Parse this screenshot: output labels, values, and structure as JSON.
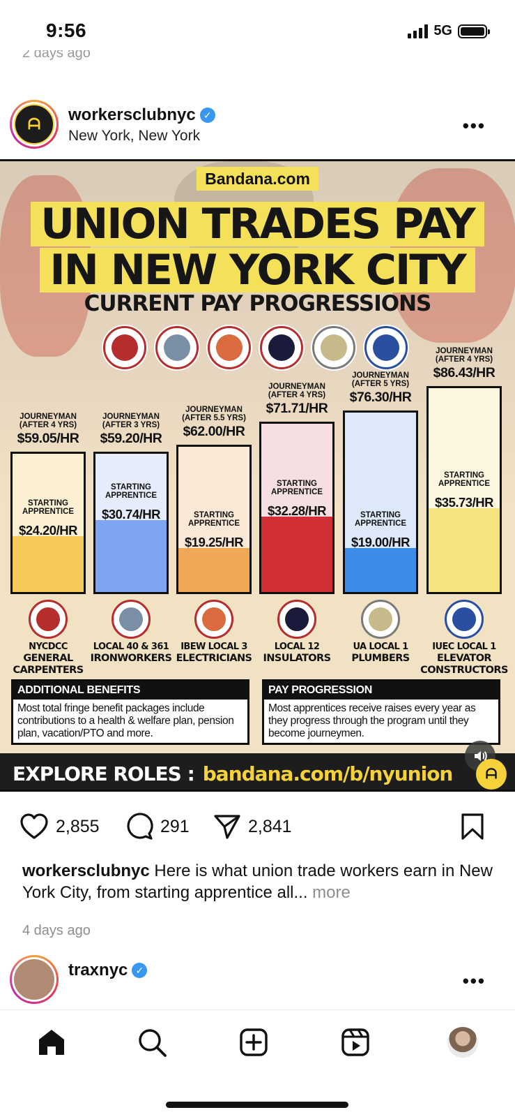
{
  "status_bar": {
    "time": "9:56",
    "network": "5G"
  },
  "previous_post": {
    "time_ago": "2 days ago"
  },
  "post": {
    "username": "workersclubnyc",
    "location": "New York, New York",
    "avatar_text": "Workers Club NYC",
    "image": {
      "brand": "Bandana.com",
      "title_line1": "UNION TRADES PAY",
      "title_line2": "IN NEW YORK CITY",
      "subtitle": "CURRENT PAY PROGRESSIONS",
      "starting_label": "STARTING APPRENTICE",
      "explore_label": "EXPLORE ROLES :",
      "explore_url": "bandana.com/b/nyunion",
      "benefits_heading": "ADDITIONAL BENEFITS",
      "benefits_text": "Most total fringe benefit packages include contributions to a health & welfare plan, pension plan, vacation/PTO and more.",
      "progression_heading": "PAY PROGRESSION",
      "progression_text": "Most apprentices receive raises every year as they progress through the program until they become journeymen."
    },
    "likes": "2,855",
    "comments": "291",
    "shares": "2,841",
    "caption_user": "workersclubnyc",
    "caption_text": "Here is what union trade workers earn in New York City, from starting apprentice all...",
    "caption_more": "more",
    "time_ago": "4 days ago"
  },
  "chart_data": {
    "type": "bar",
    "title": "UNION TRADES PAY IN NEW YORK CITY",
    "subtitle": "CURRENT PAY PROGRESSIONS",
    "categories": [
      "NYCDCC GENERAL CARPENTERS",
      "LOCAL 40 & 361 IRONWORKERS",
      "IBEW LOCAL 3 ELECTRICIANS",
      "LOCAL 12 INSULATORS",
      "UA LOCAL 1 PLUMBERS",
      "IUEC LOCAL 1 ELEVATOR CONSTRUCTORS"
    ],
    "series": [
      {
        "name": "STARTING APPRENTICE",
        "values": [
          24.2,
          30.74,
          19.25,
          32.28,
          19.0,
          35.73
        ]
      },
      {
        "name": "JOURNEYMAN",
        "values": [
          59.05,
          59.2,
          62.0,
          71.71,
          76.3,
          86.43
        ]
      }
    ],
    "ylim": [
      0,
      90
    ],
    "bars": [
      {
        "trade_line1": "NYCDCC",
        "trade_line2": "GENERAL CARPENTERS",
        "journeyman_label": "JOURNEYMAN (AFTER 4 YRS)",
        "journeyman_rate": "$59.05/HR",
        "starting_rate": "$24.20/HR",
        "journeyman": 59.05,
        "starting": 24.2,
        "fill": "#f5c95a",
        "seal": "#b52d2d"
      },
      {
        "trade_line1": "LOCAL 40 & 361",
        "trade_line2": "IRONWORKERS",
        "journeyman_label": "JOURNEYMAN (AFTER 3 YRS)",
        "journeyman_rate": "$59.20/HR",
        "starting_rate": "$30.74/HR",
        "journeyman": 59.2,
        "starting": 30.74,
        "fill": "#7fa4f2",
        "seal": "#7a8fa6"
      },
      {
        "trade_line1": "IBEW LOCAL 3",
        "trade_line2": "ELECTRICIANS",
        "journeyman_label": "JOURNEYMAN (AFTER 5.5 YRS)",
        "journeyman_rate": "$62.00/HR",
        "starting_rate": "$19.25/HR",
        "journeyman": 62.0,
        "starting": 19.25,
        "fill": "#f0a857",
        "seal": "#d96b3e"
      },
      {
        "trade_line1": "LOCAL 12",
        "trade_line2": "INSULATORS",
        "journeyman_label": "JOURNEYMAN (AFTER 4 YRS)",
        "journeyman_rate": "$71.71/HR",
        "starting_rate": "$32.28/HR",
        "journeyman": 71.71,
        "starting": 32.28,
        "fill": "#d12f34",
        "seal": "#1a1a3a"
      },
      {
        "trade_line1": "UA LOCAL 1",
        "trade_line2": "PLUMBERS",
        "journeyman_label": "JOURNEYMAN (AFTER 5 YRS)",
        "journeyman_rate": "$76.30/HR",
        "starting_rate": "$19.00/HR",
        "journeyman": 76.3,
        "starting": 19.0,
        "fill": "#3d8be8",
        "seal": "#c6b98a"
      },
      {
        "trade_line1": "IUEC LOCAL 1",
        "trade_line2": "ELEVATOR CONSTRUCTORS",
        "journeyman_label": "JOURNEYMAN (AFTER 4 YRS)",
        "journeyman_rate": "$86.43/HR",
        "starting_rate": "$35.73/HR",
        "journeyman": 86.43,
        "starting": 35.73,
        "fill": "#f5e37f",
        "seal": "#2a4fa0"
      }
    ]
  },
  "next_post": {
    "username": "traxnyc"
  },
  "icons": {
    "like": "heart-icon",
    "comment": "comment-icon",
    "share": "send-icon",
    "save": "bookmark-icon",
    "nav": [
      "home-icon",
      "search-icon",
      "create-icon",
      "reels-icon",
      "profile-avatar"
    ]
  }
}
